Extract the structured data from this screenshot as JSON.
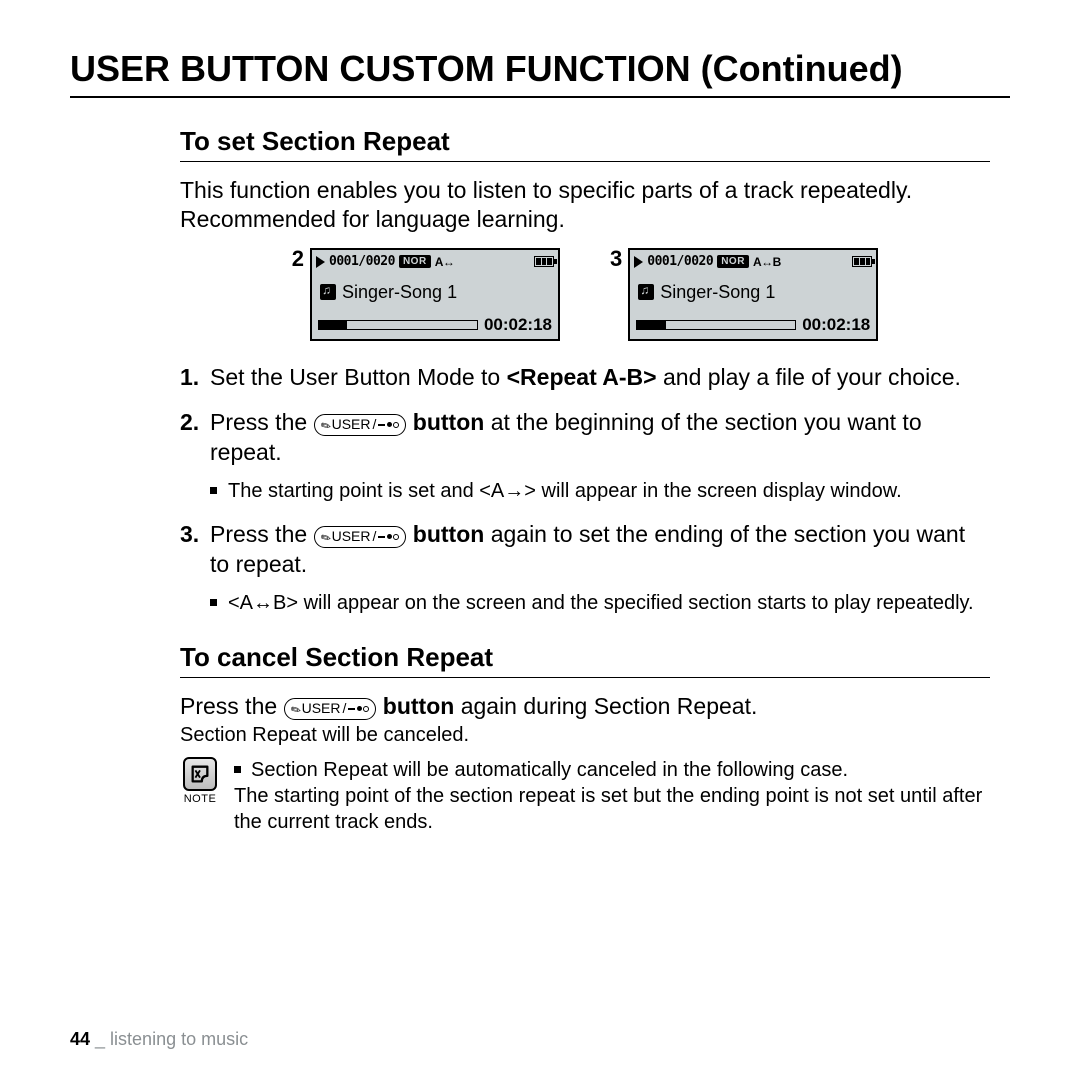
{
  "page_title": "USER BUTTON CUSTOM FUNCTION (Continued)",
  "set": {
    "heading": "To set Section Repeat",
    "intro": "This function enables you to listen to specific parts of a track repeatedly. Recommended for language learning.",
    "screens": [
      {
        "num": "2",
        "counter": "0001/0020",
        "mode": "NOR",
        "ab": "A↔",
        "song": "Singer-Song 1",
        "time": "00:02:18"
      },
      {
        "num": "3",
        "counter": "0001/0020",
        "mode": "NOR",
        "ab": "A↔B",
        "song": "Singer-Song 1",
        "time": "00:02:18"
      }
    ],
    "steps": {
      "s1_a": "Set the User Button Mode to ",
      "s1_b": "<Repeat A-B>",
      "s1_c": " and play a file of your choice.",
      "s2_a": "Press the ",
      "s2_b": " button",
      "s2_c": " at the beginning of the section you want to repeat.",
      "s2_sub": "The starting point is set and <A→> will appear in the screen display window.",
      "s3_a": "Press the ",
      "s3_b": " button",
      "s3_c": " again to set the ending of the section you want to repeat.",
      "s3_sub": "<A↔B> will appear on the screen and the specified section starts to play repeatedly."
    }
  },
  "cancel": {
    "heading": "To cancel Section Repeat",
    "line_a": "Press the ",
    "line_b": " button",
    "line_c": " again during Section Repeat.",
    "small": "Section Repeat will be canceled.",
    "note_label": "NOTE",
    "note_lead": "Section Repeat will be automatically canceled in the following case.",
    "note_body": "The starting point of the section repeat is set but the ending point is not set until after the current track ends."
  },
  "user_btn_label": "USER",
  "footer": {
    "page": "44",
    "sep": " _ ",
    "chapter": "listening to music"
  }
}
